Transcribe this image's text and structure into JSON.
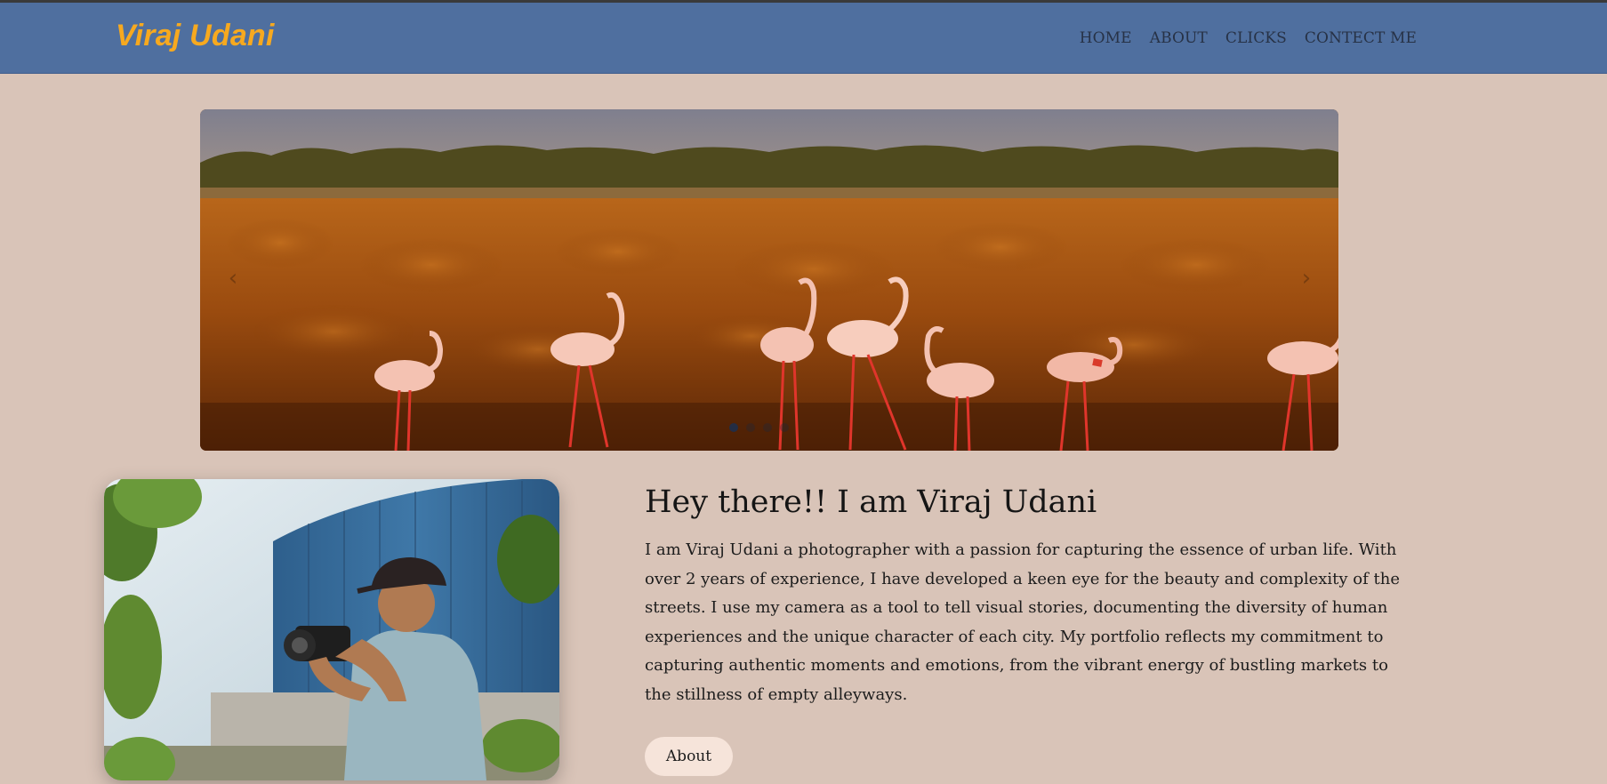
{
  "site": {
    "brand": "Viraj Udani"
  },
  "nav": {
    "items": [
      {
        "label": "HOME"
      },
      {
        "label": "ABOUT"
      },
      {
        "label": "CLICKS"
      },
      {
        "label": "CONTECT ME"
      }
    ]
  },
  "carousel": {
    "slides_count": 4,
    "active_index": 0,
    "prev_icon": "chevron-left-icon",
    "next_icon": "chevron-right-icon",
    "image": "flamingos-walking-in-reddish-earth-field"
  },
  "about": {
    "title": "Hey there!! I am Viraj Udani",
    "paragraph": "I am Viraj Udani a photographer with a passion for capturing the essence of urban life. With over 2 years of experience, I have developed a keen eye for the beauty and complexity of the streets. I use my camera as a tool to tell visual stories, documenting the diversity of human experiences and the unique character of each city. My portfolio reflects my commitment to capturing authentic moments and emotions, from the vibrant energy of bustling markets to the stillness of empty alleyways.",
    "button_label": "About",
    "portrait": "photographer-with-camera-outdoors"
  },
  "colors": {
    "page_bg": "#d9c4b8",
    "navbar_bg": "#4f6f9f",
    "brand": "#f7a91f",
    "button_bg": "#f6e4da"
  }
}
